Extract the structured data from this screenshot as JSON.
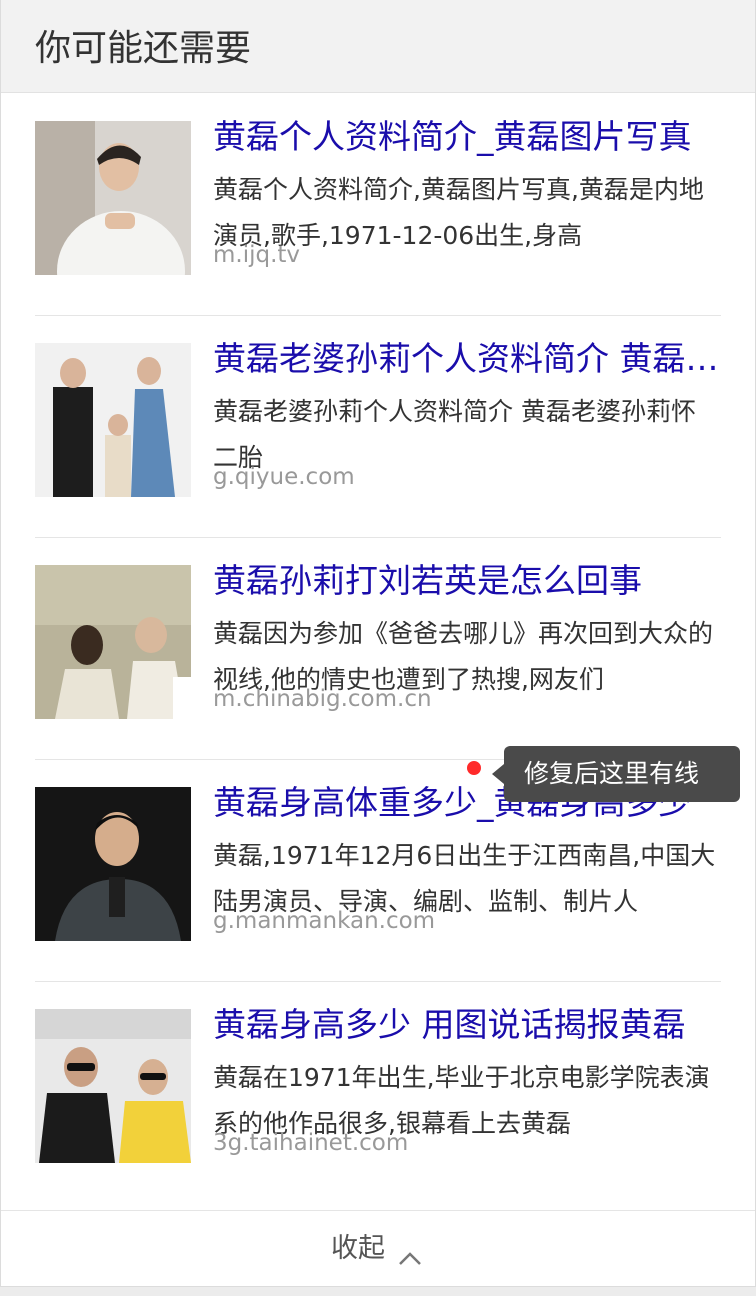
{
  "header": {
    "title": "你可能还需要"
  },
  "results": [
    {
      "title": "黄磊个人资料简介_黄磊图片写真",
      "desc": "黄磊个人资料简介,黄磊图片写真,黄磊是内地演员,歌手,1971-12-06出生,身高",
      "source": "m.ijq.tv"
    },
    {
      "title": "黄磊老婆孙莉个人资料简介 黄磊老婆孙莉怀二胎",
      "desc": "黄磊老婆孙莉个人资料简介 黄磊老婆孙莉怀二胎",
      "source": "g.qiyue.com"
    },
    {
      "title": "黄磊孙莉打刘若英是怎么回事",
      "desc": "黄磊因为参加《爸爸去哪儿》再次回到大众的视线,他的情史也遭到了热搜,网友们",
      "source": "m.chinabig.com.cn"
    },
    {
      "title": "黄磊身高体重多少_黄磊身高多少",
      "desc": "黄磊,1971年12月6日出生于江西南昌,中国大陆男演员、导演、编剧、监制、制片人",
      "source": "g.manmankan.com"
    },
    {
      "title": "黄磊身高多少 用图说话揭报黄磊",
      "desc": "黄磊在1971年出生,毕业于北京电影学院表演系的他作品很多,银幕看上去黄磊",
      "source": "3g.taihainet.com"
    }
  ],
  "footer": {
    "collapse_label": "收起",
    "icon": "chevron-up-icon"
  },
  "tooltip": {
    "text": "修复后这里有线"
  },
  "colors": {
    "title": "#1a0dab",
    "desc": "#333333",
    "source": "#999999",
    "tooltip_bg": "#4a4a4a",
    "dot": "#ff2a2a"
  }
}
